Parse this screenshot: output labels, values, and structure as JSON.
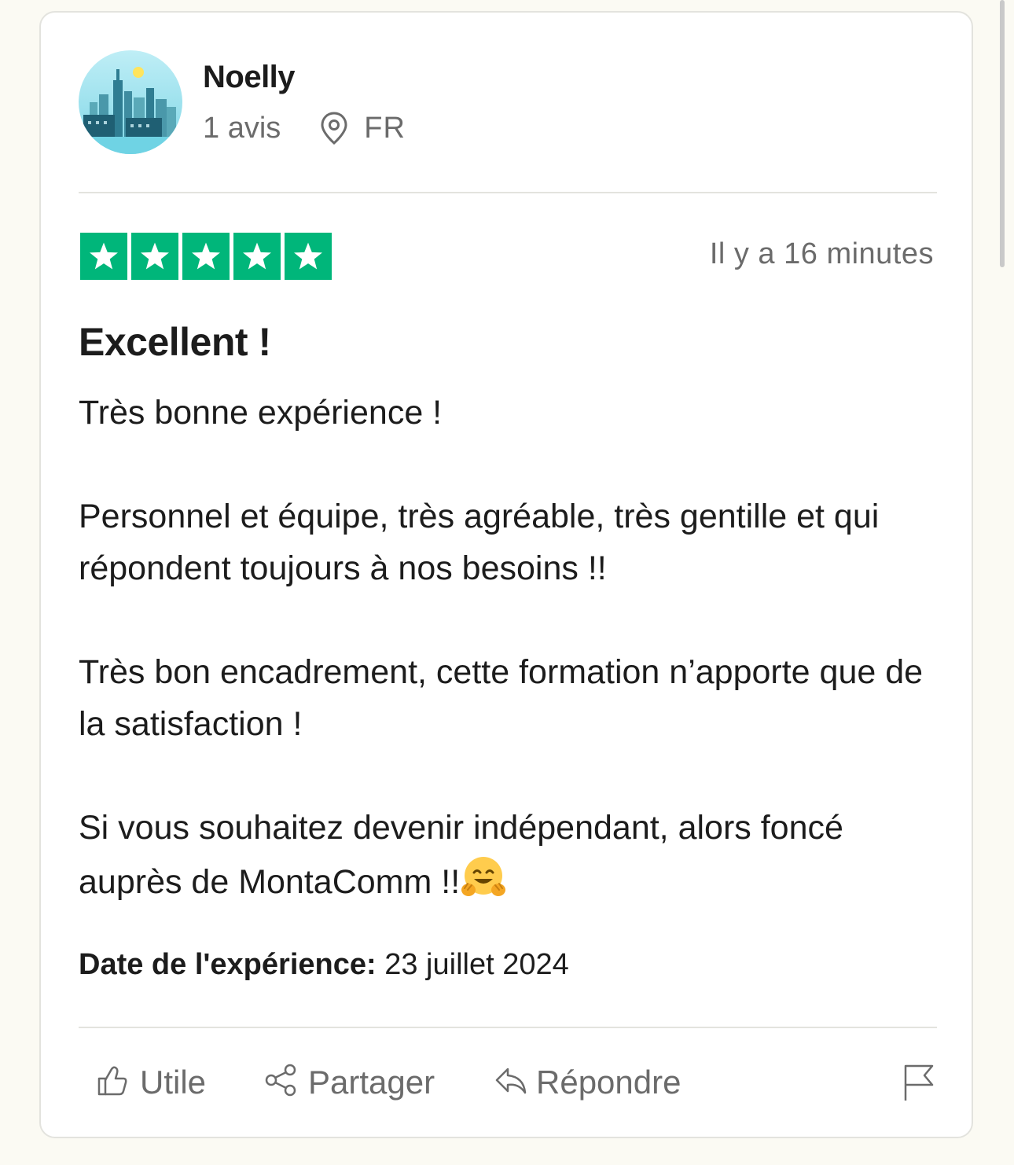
{
  "reviewer": {
    "name": "Noelly",
    "reviews_count": "1 avis",
    "country": "FR",
    "avatar_icon": "city-skyline-avatar"
  },
  "review": {
    "rating": 5,
    "rating_max": 5,
    "star_color": "#00b67a",
    "time_ago": "Il y a 16 minutes",
    "title": "Excellent !",
    "paragraphs": [
      "Très bonne expérience !",
      "Personnel et équipe, très agréable, très gentille et qui répondent toujours à nos besoins !!",
      "Très bon encadrement, cette formation n’apporte que de la satisfaction !",
      "Si vous souhaitez devenir indépendant, alors foncé auprès de MontaComm !!"
    ],
    "trailing_emoji": "hugging-face-emoji",
    "experience_label": "Date de l'expérience:",
    "experience_date": "23 juillet 2024"
  },
  "actions": {
    "useful_label": "Utile",
    "share_label": "Partager",
    "reply_label": "Répondre",
    "report_icon": "flag-icon"
  }
}
